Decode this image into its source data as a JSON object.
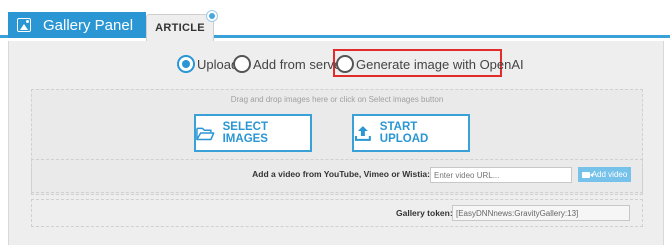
{
  "header": {
    "title": "Gallery Panel",
    "title_icon": "image-icon",
    "tabs": [
      {
        "label": "ARTICLE",
        "active": true
      }
    ],
    "accent_color": "#2a96d3"
  },
  "options": {
    "items": [
      {
        "label": "Upload",
        "selected": true
      },
      {
        "label": "Add from server",
        "selected": false
      },
      {
        "label": "Generate image with OpenAI",
        "selected": false
      }
    ],
    "highlight_color": "#e22b2b"
  },
  "dropzone": {
    "hint": "Drag and drop images here or click on Select images button",
    "select_label": "SELECT IMAGES",
    "upload_label": "START UPLOAD",
    "select_icon": "folder-open-icon",
    "upload_icon": "upload-icon"
  },
  "video": {
    "label": "Add a video from YouTube, Vimeo or Wistia:",
    "placeholder": "Enter video URL...",
    "button_label": "Add video",
    "button_icon": "video-camera-icon"
  },
  "token": {
    "label": "Gallery token:",
    "value": "[EasyDNNnews:GravityGallery:13]"
  }
}
